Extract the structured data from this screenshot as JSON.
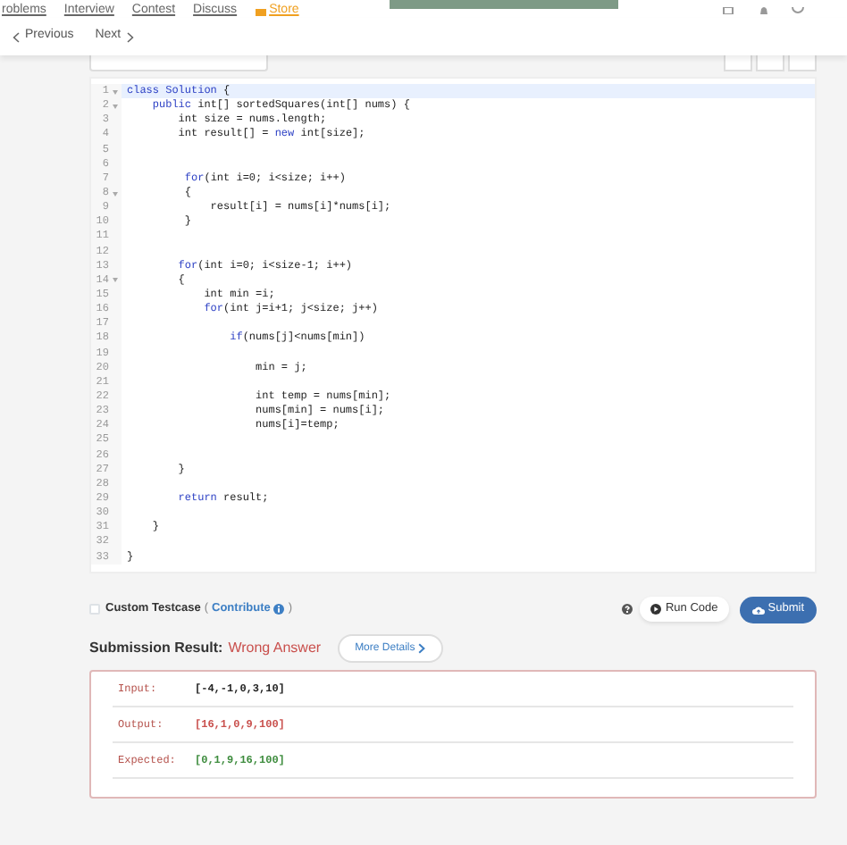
{
  "top_nav": [
    {
      "label": "roblems",
      "kind": "plain"
    },
    {
      "label": "Interview",
      "kind": "plain"
    },
    {
      "label": "Contest",
      "kind": "plain"
    },
    {
      "label": "Discuss",
      "kind": "plain"
    },
    {
      "label": "Store",
      "kind": "store"
    }
  ],
  "pager": {
    "previous": "Previous",
    "next": "Next"
  },
  "editor": {
    "lines": [
      {
        "number": "1",
        "foldable": true,
        "active": true,
        "segments": [
          {
            "t": "class Solution",
            "kind": "keyword"
          },
          {
            "t": " {",
            "kind": "plain"
          }
        ]
      },
      {
        "number": "2",
        "foldable": true,
        "active": false,
        "segments": [
          {
            "t": "    public",
            "kind": "keyword"
          },
          {
            "t": " int[] sortedSquares(int[] nums) {",
            "kind": "plain"
          }
        ]
      },
      {
        "number": "3",
        "foldable": false,
        "active": false,
        "segments": [
          {
            "t": "        int size = nums.length;",
            "kind": "plain"
          }
        ]
      },
      {
        "number": "4",
        "foldable": false,
        "active": false,
        "segments": [
          {
            "t": "        int result[] = ",
            "kind": "plain"
          },
          {
            "t": "new",
            "kind": "keyword"
          },
          {
            "t": " int[size];",
            "kind": "plain"
          }
        ]
      },
      {
        "number": "5",
        "foldable": false,
        "active": false
      },
      {
        "number": "6",
        "foldable": false,
        "active": false
      },
      {
        "number": "7",
        "foldable": false,
        "active": false,
        "segments": [
          {
            "t": "         for",
            "kind": "keyword"
          },
          {
            "t": "(int i=0; i<size; i++)",
            "kind": "plain"
          }
        ]
      },
      {
        "number": "8",
        "foldable": true,
        "active": false,
        "segments": [
          {
            "t": "         {",
            "kind": "plain"
          }
        ]
      },
      {
        "number": "9",
        "foldable": false,
        "active": false,
        "segments": [
          {
            "t": "             result[i] = nums[i]*nums[i];",
            "kind": "plain"
          }
        ]
      },
      {
        "number": "10",
        "foldable": false,
        "active": false,
        "segments": [
          {
            "t": "         }",
            "kind": "plain"
          }
        ]
      },
      {
        "number": "11",
        "foldable": false,
        "active": false
      },
      {
        "number": "12",
        "foldable": false,
        "active": false
      },
      {
        "number": "13",
        "foldable": false,
        "active": false,
        "segments": [
          {
            "t": "        for",
            "kind": "keyword"
          },
          {
            "t": "(int i=0; i<size-1; i++)",
            "kind": "plain"
          }
        ]
      },
      {
        "number": "14",
        "foldable": true,
        "active": false,
        "segments": [
          {
            "t": "        {",
            "kind": "plain"
          }
        ]
      },
      {
        "number": "15",
        "foldable": false,
        "active": false,
        "segments": [
          {
            "t": "            int min =i;",
            "kind": "plain"
          }
        ]
      },
      {
        "number": "16",
        "foldable": false,
        "active": false,
        "segments": [
          {
            "t": "            for",
            "kind": "keyword"
          },
          {
            "t": "(int j=i+1; j<size; j++)",
            "kind": "plain"
          }
        ]
      },
      {
        "number": "17",
        "foldable": false,
        "active": false
      },
      {
        "number": "18",
        "foldable": false,
        "active": false,
        "segments": [
          {
            "t": "                if",
            "kind": "keyword"
          },
          {
            "t": "(nums[j]<nums[min])",
            "kind": "plain"
          }
        ]
      },
      {
        "number": "19",
        "foldable": false,
        "active": false
      },
      {
        "number": "20",
        "foldable": false,
        "active": false,
        "segments": [
          {
            "t": "                    min = j;",
            "kind": "plain"
          }
        ]
      },
      {
        "number": "21",
        "foldable": false,
        "active": false
      },
      {
        "number": "22",
        "foldable": false,
        "active": false,
        "segments": [
          {
            "t": "                    int temp = nums[min];",
            "kind": "plain"
          }
        ]
      },
      {
        "number": "23",
        "foldable": false,
        "active": false,
        "segments": [
          {
            "t": "                    nums[min] = nums[i];",
            "kind": "plain"
          }
        ]
      },
      {
        "number": "24",
        "foldable": false,
        "active": false,
        "segments": [
          {
            "t": "                    nums[i]=temp;",
            "kind": "plain"
          }
        ]
      },
      {
        "number": "25",
        "foldable": false,
        "active": false
      },
      {
        "number": "26",
        "foldable": false,
        "active": false
      },
      {
        "number": "27",
        "foldable": false,
        "active": false,
        "segments": [
          {
            "t": "        }",
            "kind": "plain"
          }
        ]
      },
      {
        "number": "28",
        "foldable": false,
        "active": false
      },
      {
        "number": "29",
        "foldable": false,
        "active": false,
        "segments": [
          {
            "t": "        return",
            "kind": "keyword"
          },
          {
            "t": " result;",
            "kind": "plain"
          }
        ]
      },
      {
        "number": "30",
        "foldable": false,
        "active": false
      },
      {
        "number": "31",
        "foldable": false,
        "active": false,
        "segments": [
          {
            "t": "    }",
            "kind": "plain"
          }
        ]
      },
      {
        "number": "32",
        "foldable": false,
        "active": false
      },
      {
        "number": "33",
        "foldable": false,
        "active": false,
        "segments": [
          {
            "t": "}",
            "kind": "plain"
          }
        ]
      }
    ]
  },
  "custom_testcase": {
    "label": "Custom Testcase",
    "checked": false,
    "open_paren": "(",
    "link": "Contribute",
    "close_paren": ")"
  },
  "buttons": {
    "run": "Run Code",
    "submit": "Submit"
  },
  "result": {
    "label": "Submission Result:",
    "verdict": "Wrong Answer",
    "details": "More Details",
    "rows": [
      {
        "label": "Input:",
        "value": "[-4,-1,0,3,10]",
        "color": "#222222"
      },
      {
        "label": "Output:",
        "value": "[16,1,0,9,100]",
        "color": "#c9504d"
      },
      {
        "label": "Expected:",
        "value": "[0,1,9,16,100]",
        "color": "#3d8c3d"
      }
    ]
  }
}
